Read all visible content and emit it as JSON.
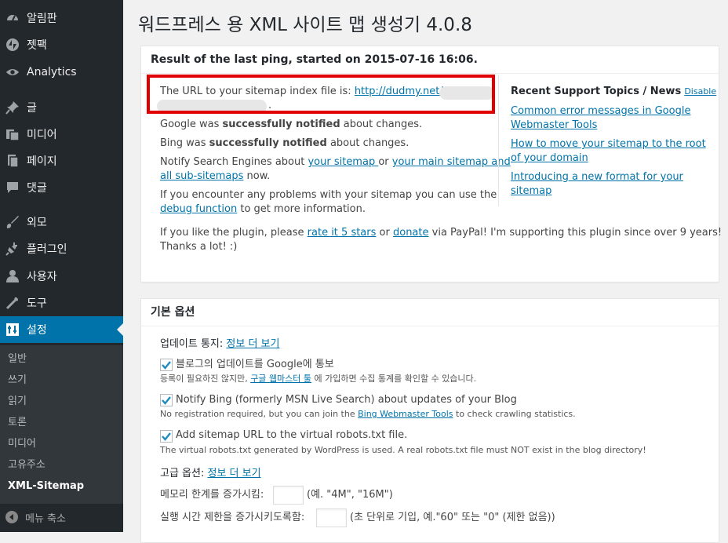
{
  "colors": {
    "sidebar_bg": "#23282d",
    "accent": "#0073aa",
    "highlight": "#e10000",
    "link": "#0073aa"
  },
  "sidebar": {
    "items": [
      {
        "label": "알림판",
        "icon": "dashboard-icon"
      },
      {
        "label": "젯팩",
        "icon": "jetpack-icon"
      },
      {
        "label": "Analytics",
        "icon": "analytics-icon"
      },
      {
        "label": "글",
        "icon": "pin-icon"
      },
      {
        "label": "미디어",
        "icon": "media-icon"
      },
      {
        "label": "페이지",
        "icon": "page-icon"
      },
      {
        "label": "댓글",
        "icon": "comment-icon"
      },
      {
        "label": "외모",
        "icon": "brush-icon"
      },
      {
        "label": "플러그인",
        "icon": "plugin-icon"
      },
      {
        "label": "사용자",
        "icon": "user-icon"
      },
      {
        "label": "도구",
        "icon": "wrench-icon"
      },
      {
        "label": "설정",
        "icon": "settings-icon"
      }
    ],
    "submenu": [
      "일반",
      "쓰기",
      "읽기",
      "토론",
      "미디어",
      "고유주소",
      "XML-Sitemap"
    ],
    "collapse": "메뉴 축소"
  },
  "page": {
    "title": "워드프레스 용 XML 사이트 맵 생성기 4.0.8"
  },
  "ping": {
    "header": "Result of the last ping, started on 2015-07-16 16:06.",
    "url_prefix": "The URL to your sitemap index file is: ",
    "url_link": "http://dudmy.net/",
    "url_end": ".",
    "google_pre": "Google was ",
    "google_bold": "successfully notified",
    "google_post": " about changes.",
    "bing_pre": "Bing was ",
    "bing_bold": "successfully notified",
    "bing_post": " about changes.",
    "notify_pre": "Notify Search Engines about ",
    "notify_link1": "your sitemap ",
    "notify_mid": "or ",
    "notify_link2a": "your main sitemap and",
    "notify_link2b": "all sub-sitemaps",
    "notify_post": " now.",
    "problems_line1": "If you encounter any problems with your sitemap you can use the",
    "problems_link": "debug function",
    "problems_post": " to get more information.",
    "like_pre": "If you like the plugin, please ",
    "like_link1": "rate it 5 stars",
    "like_mid": " or ",
    "like_link2": "donate",
    "like_post": " via PayPal! I'm supporting this plugin since over 9 years!",
    "thanks": "Thanks a lot! :)"
  },
  "support": {
    "title": "Recent Support Topics / News",
    "disable": "Disable",
    "topics": [
      [
        "Common error messages in Google",
        "Webmaster Tools"
      ],
      [
        "How to move your sitemap to the root",
        "of your domain"
      ],
      [
        "Introducing a new format for your",
        "sitemap"
      ]
    ]
  },
  "basic": {
    "header": "기본 옵션",
    "update_label": "업데이트 통지: ",
    "update_link": "정보 더 보기",
    "opt1_label": "블로그의 업데이트를 Google에 통보",
    "opt1_desc_pre": "등록이 필요하진 않지만, ",
    "opt1_desc_link": "구글 웹마스터 툴",
    "opt1_desc_post": " 에 가입하면 수집 통계를 확인할 수 있습니다.",
    "opt2_label": "Notify Bing (formerly MSN Live Search) about updates of your Blog",
    "opt2_desc_pre": "No registration required, but you can join the ",
    "opt2_desc_link": "Bing Webmaster Tools",
    "opt2_desc_post": " to check crawling statistics.",
    "opt3_label": "Add sitemap URL to the virtual robots.txt file.",
    "opt3_desc": "The virtual robots.txt generated by WordPress is used. A real robots.txt file must NOT exist in the blog directory!",
    "adv_label": "고급 옵션: ",
    "adv_link": "정보 더 보기",
    "mem_label": "메모리 한계를 증가시킴:",
    "mem_hint": "(예. \"4M\", \"16M\")",
    "time_label": "실행 시간 제한을 증가시키도록함:",
    "time_hint": "(초 단위로 기입, 예.\"60\" 또는 \"0\" (제한 없음))"
  }
}
